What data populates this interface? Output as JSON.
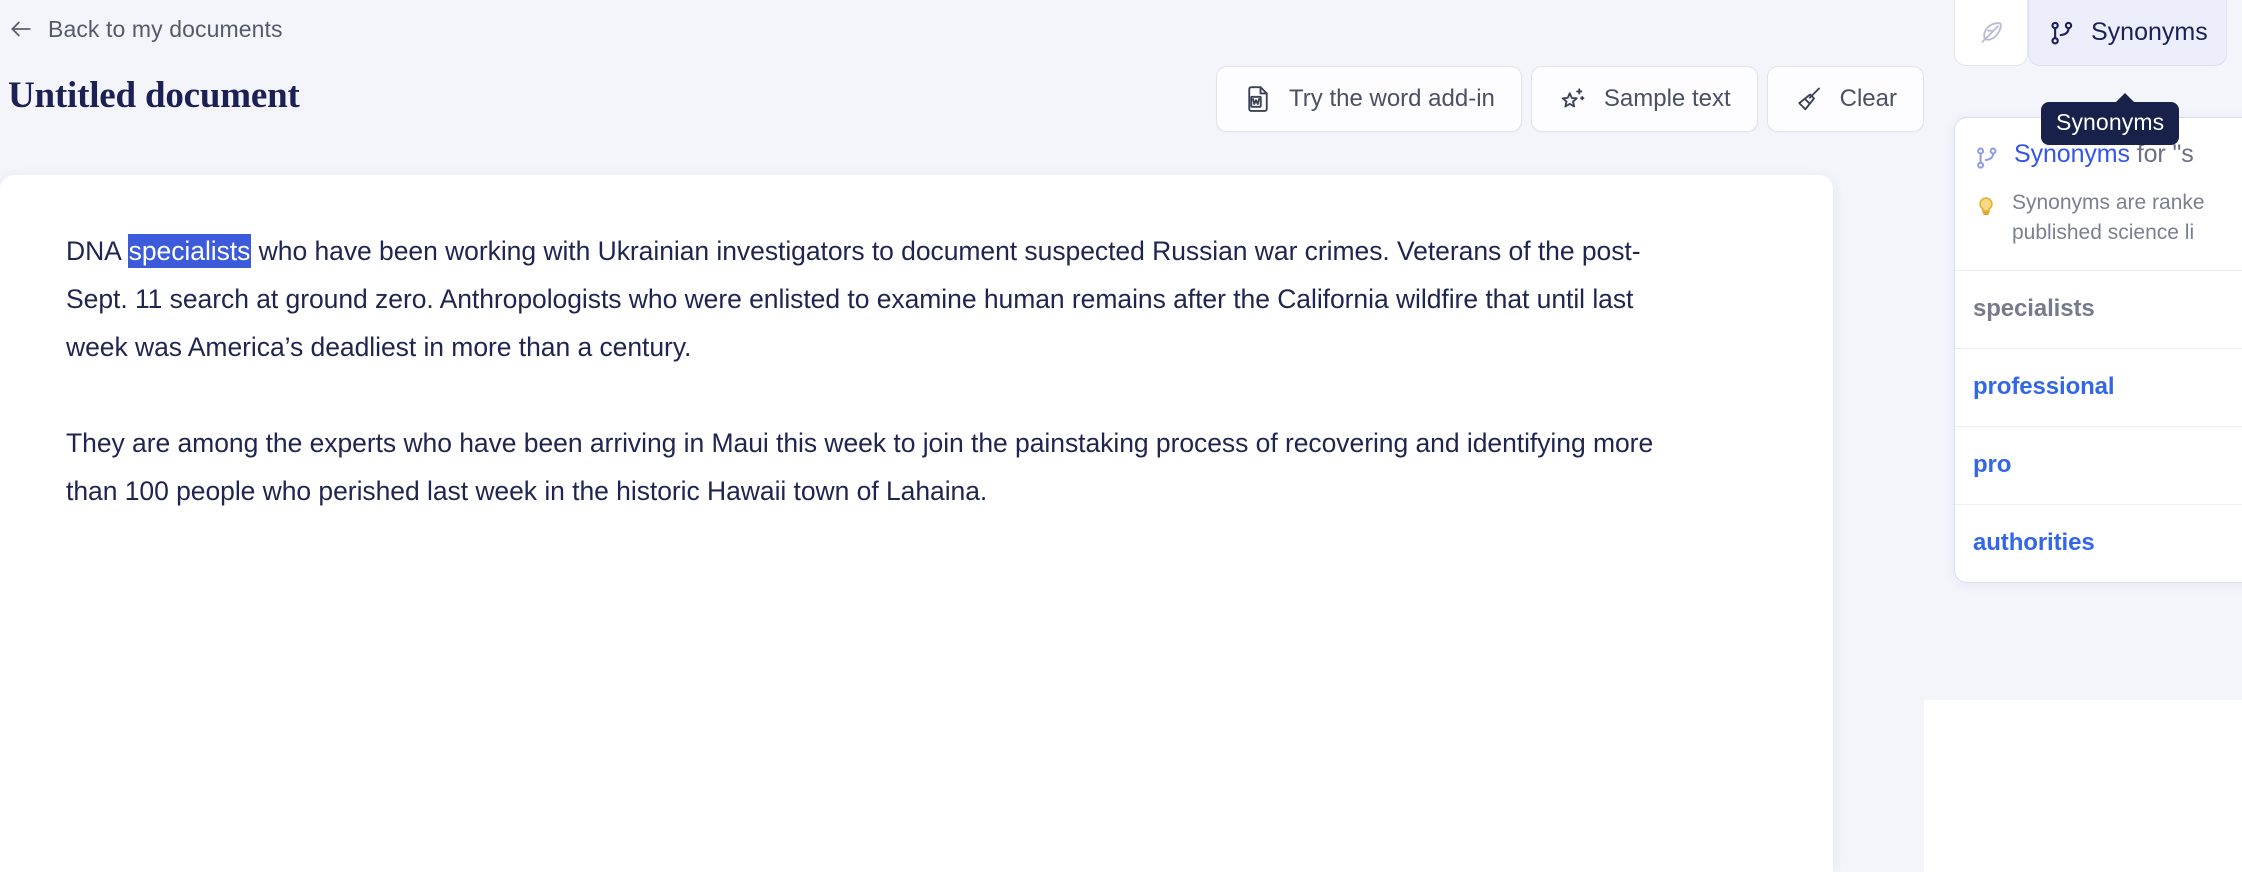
{
  "nav": {
    "back_label": "Back to my documents",
    "back_icon": "arrow-left-icon"
  },
  "document": {
    "title": "Untitled document",
    "paragraphs": [
      {
        "segments": [
          {
            "text": "DNA ",
            "selected": false
          },
          {
            "text": "specialists",
            "selected": true
          },
          {
            "text": " who have been working with Ukrainian investigators to document suspected Russian war crimes. Veterans of the post-Sept. 11 search at ground zero. Anthropologists who were enlisted to examine human remains after the California wildfire that until last week was America’s deadliest in more than a century.",
            "selected": false
          }
        ]
      },
      {
        "segments": [
          {
            "text": "They are among the experts who have been arriving in Maui this week to join the painstaking process of recovering and identifying more than 100 people who perished last week in the historic Hawaii town of Lahaina.",
            "selected": false
          }
        ]
      }
    ]
  },
  "toolbar": {
    "buttons": [
      {
        "label": "Try the word add-in",
        "icon": "word-document-icon"
      },
      {
        "label": "Sample text",
        "icon": "sparkle-star-icon"
      },
      {
        "label": "Clear",
        "icon": "broom-icon"
      }
    ]
  },
  "side_panel": {
    "tabs": [
      {
        "label": "",
        "icon": "feather-pen-icon",
        "active": false
      },
      {
        "label": "Synonyms",
        "icon": "git-branch-icon",
        "active": true
      }
    ],
    "tooltip": "Synonyms",
    "header": {
      "icon": "git-branch-icon",
      "keyword": "Synonyms",
      "suffix": " for \"s"
    },
    "hint": {
      "icon": "lightbulb-icon",
      "line1": "Synonyms are ranke",
      "line2": "published science li"
    },
    "synonyms": [
      {
        "label": "specialists",
        "current": true
      },
      {
        "label": "professional",
        "current": false
      },
      {
        "label": "pro",
        "current": false
      },
      {
        "label": "authorities",
        "current": false
      }
    ]
  },
  "colors": {
    "page_bg": "#f4f4fb",
    "sheet_bg": "#ffffff",
    "title": "#1b2055",
    "selection": "#3b5bdb",
    "synonym_link": "#3366e8",
    "tooltip_bg": "#18214a"
  }
}
